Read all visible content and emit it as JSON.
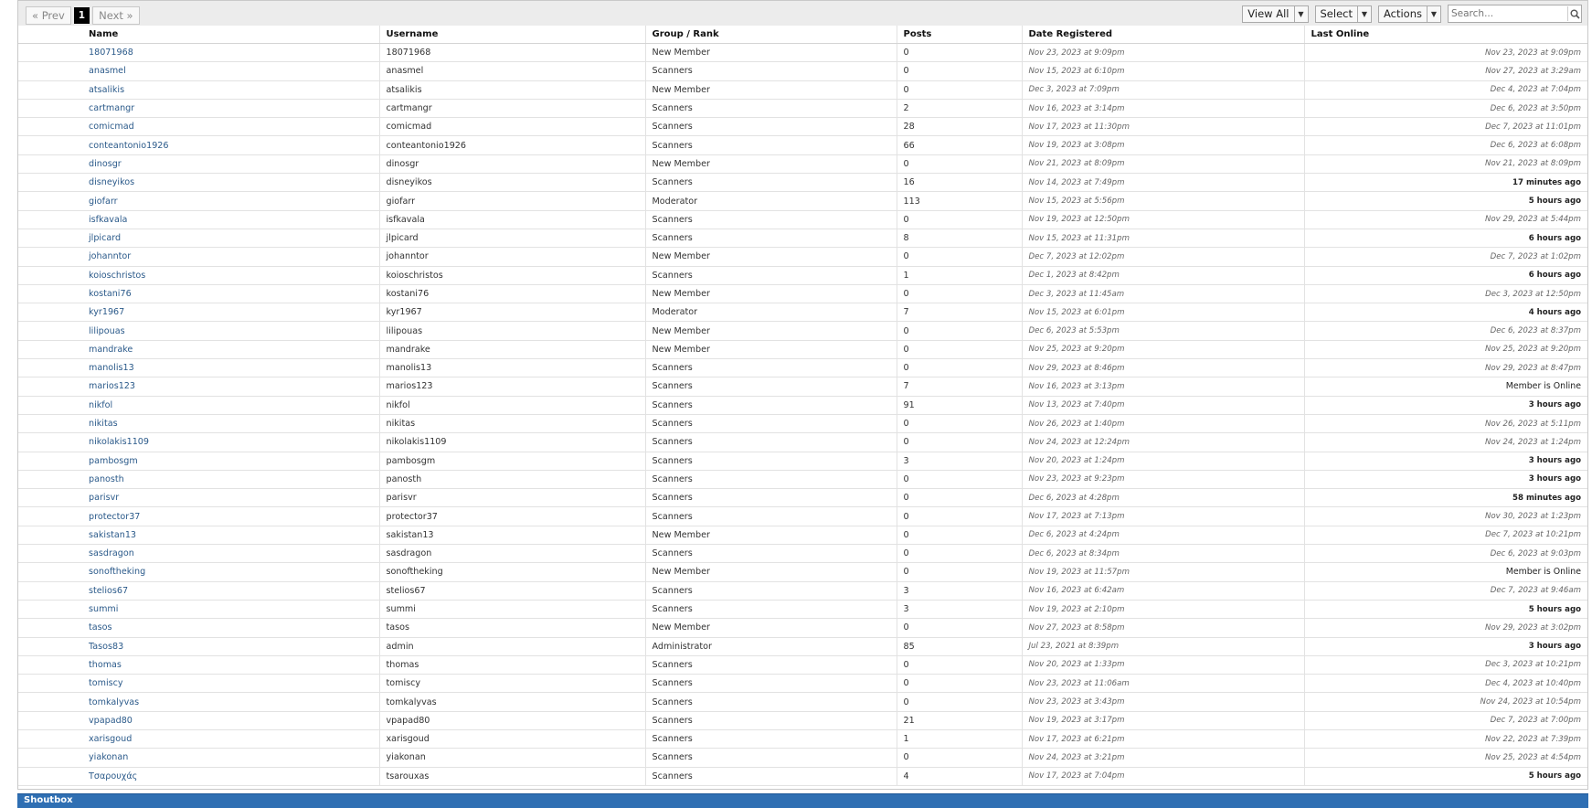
{
  "pagination": {
    "prev": "« Prev",
    "current": "1",
    "next": "Next »"
  },
  "tools": {
    "view_all": "View All",
    "select": "Select",
    "actions": "Actions",
    "search_placeholder": "Search..."
  },
  "columns": {
    "name": "Name",
    "username": "Username",
    "group": "Group / Rank",
    "posts": "Posts",
    "registered": "Date Registered",
    "last_online": "Last Online"
  },
  "members": [
    {
      "name": "18071968",
      "username": "18071968",
      "group": "New Member",
      "posts": "0",
      "registered": "Nov 23, 2023 at 9:09pm",
      "last": "Nov 23, 2023 at 9:09pm"
    },
    {
      "name": "anasmel",
      "username": "anasmel",
      "group": "Scanners",
      "posts": "0",
      "registered": "Nov 15, 2023 at 6:10pm",
      "last": "Nov 27, 2023 at 3:29am"
    },
    {
      "name": "atsalikis",
      "username": "atsalikis",
      "group": "New Member",
      "posts": "0",
      "registered": "Dec 3, 2023 at 7:09pm",
      "last": "Dec 4, 2023 at 7:04pm"
    },
    {
      "name": "cartmangr",
      "username": "cartmangr",
      "group": "Scanners",
      "posts": "2",
      "registered": "Nov 16, 2023 at 3:14pm",
      "last": "Dec 6, 2023 at 3:50pm"
    },
    {
      "name": "comicmad",
      "username": "comicmad",
      "group": "Scanners",
      "posts": "28",
      "registered": "Nov 17, 2023 at 11:30pm",
      "last": "Dec 7, 2023 at 11:01pm"
    },
    {
      "name": "conteantonio1926",
      "username": "conteantonio1926",
      "group": "Scanners",
      "posts": "66",
      "registered": "Nov 19, 2023 at 3:08pm",
      "last": "Dec 6, 2023 at 6:08pm"
    },
    {
      "name": "dinosgr",
      "username": "dinosgr",
      "group": "New Member",
      "posts": "0",
      "registered": "Nov 21, 2023 at 8:09pm",
      "last": "Nov 21, 2023 at 8:09pm"
    },
    {
      "name": "disneyikos",
      "username": "disneyikos",
      "group": "Scanners",
      "posts": "16",
      "registered": "Nov 14, 2023 at 7:49pm",
      "last": "17 minutes ago"
    },
    {
      "name": "giofarr",
      "username": "giofarr",
      "group": "Moderator",
      "posts": "113",
      "registered": "Nov 15, 2023 at 5:56pm",
      "last": "5 hours ago"
    },
    {
      "name": "isfkavala",
      "username": "isfkavala",
      "group": "Scanners",
      "posts": "0",
      "registered": "Nov 19, 2023 at 12:50pm",
      "last": "Nov 29, 2023 at 5:44pm"
    },
    {
      "name": "jlpicard",
      "username": "jlpicard",
      "group": "Scanners",
      "posts": "8",
      "registered": "Nov 15, 2023 at 11:31pm",
      "last": "6 hours ago"
    },
    {
      "name": "johanntor",
      "username": "johanntor",
      "group": "New Member",
      "posts": "0",
      "registered": "Dec 7, 2023 at 12:02pm",
      "last": "Dec 7, 2023 at 1:02pm"
    },
    {
      "name": "koioschristos",
      "username": "koioschristos",
      "group": "Scanners",
      "posts": "1",
      "registered": "Dec 1, 2023 at 8:42pm",
      "last": "6 hours ago"
    },
    {
      "name": "kostani76",
      "username": "kostani76",
      "group": "New Member",
      "posts": "0",
      "registered": "Dec 3, 2023 at 11:45am",
      "last": "Dec 3, 2023 at 12:50pm"
    },
    {
      "name": "kyr1967",
      "username": "kyr1967",
      "group": "Moderator",
      "posts": "7",
      "registered": "Nov 15, 2023 at 6:01pm",
      "last": "4 hours ago"
    },
    {
      "name": "lilipouas",
      "username": "lilipouas",
      "group": "New Member",
      "posts": "0",
      "registered": "Dec 6, 2023 at 5:53pm",
      "last": "Dec 6, 2023 at 8:37pm"
    },
    {
      "name": "mandrake",
      "username": "mandrake",
      "group": "New Member",
      "posts": "0",
      "registered": "Nov 25, 2023 at 9:20pm",
      "last": "Nov 25, 2023 at 9:20pm"
    },
    {
      "name": "manolis13",
      "username": "manolis13",
      "group": "Scanners",
      "posts": "0",
      "registered": "Nov 29, 2023 at 8:46pm",
      "last": "Nov 29, 2023 at 8:47pm"
    },
    {
      "name": "marios123",
      "username": "marios123",
      "group": "Scanners",
      "posts": "7",
      "registered": "Nov 16, 2023 at 3:13pm",
      "last": "Member is Online"
    },
    {
      "name": "nikfol",
      "username": "nikfol",
      "group": "Scanners",
      "posts": "91",
      "registered": "Nov 13, 2023 at 7:40pm",
      "last": "3 hours ago"
    },
    {
      "name": "nikitas",
      "username": "nikitas",
      "group": "Scanners",
      "posts": "0",
      "registered": "Nov 26, 2023 at 1:40pm",
      "last": "Nov 26, 2023 at 5:11pm"
    },
    {
      "name": "nikolakis1109",
      "username": "nikolakis1109",
      "group": "Scanners",
      "posts": "0",
      "registered": "Nov 24, 2023 at 12:24pm",
      "last": "Nov 24, 2023 at 1:24pm"
    },
    {
      "name": "pambosgm",
      "username": "pambosgm",
      "group": "Scanners",
      "posts": "3",
      "registered": "Nov 20, 2023 at 1:24pm",
      "last": "3 hours ago"
    },
    {
      "name": "panosth",
      "username": "panosth",
      "group": "Scanners",
      "posts": "0",
      "registered": "Nov 23, 2023 at 9:23pm",
      "last": "3 hours ago"
    },
    {
      "name": "parisvr",
      "username": "parisvr",
      "group": "Scanners",
      "posts": "0",
      "registered": "Dec 6, 2023 at 4:28pm",
      "last": "58 minutes ago"
    },
    {
      "name": "protector37",
      "username": "protector37",
      "group": "Scanners",
      "posts": "0",
      "registered": "Nov 17, 2023 at 7:13pm",
      "last": "Nov 30, 2023 at 1:23pm"
    },
    {
      "name": "sakistan13",
      "username": "sakistan13",
      "group": "New Member",
      "posts": "0",
      "registered": "Dec 6, 2023 at 4:24pm",
      "last": "Dec 7, 2023 at 10:21pm"
    },
    {
      "name": "sasdragon",
      "username": "sasdragon",
      "group": "Scanners",
      "posts": "0",
      "registered": "Dec 6, 2023 at 8:34pm",
      "last": "Dec 6, 2023 at 9:03pm"
    },
    {
      "name": "sonoftheking",
      "username": "sonoftheking",
      "group": "New Member",
      "posts": "0",
      "registered": "Nov 19, 2023 at 11:57pm",
      "last": "Member is Online"
    },
    {
      "name": "stelios67",
      "username": "stelios67",
      "group": "Scanners",
      "posts": "3",
      "registered": "Nov 16, 2023 at 6:42am",
      "last": "Dec 7, 2023 at 9:46am"
    },
    {
      "name": "summi",
      "username": "summi",
      "group": "Scanners",
      "posts": "3",
      "registered": "Nov 19, 2023 at 2:10pm",
      "last": "5 hours ago"
    },
    {
      "name": "tasos",
      "username": "tasos",
      "group": "New Member",
      "posts": "0",
      "registered": "Nov 27, 2023 at 8:58pm",
      "last": "Nov 29, 2023 at 3:02pm"
    },
    {
      "name": "Tasos83",
      "username": "admin",
      "group": "Administrator",
      "posts": "85",
      "registered": "Jul 23, 2021 at 8:39pm",
      "last": "3 hours ago"
    },
    {
      "name": "thomas",
      "username": "thomas",
      "group": "Scanners",
      "posts": "0",
      "registered": "Nov 20, 2023 at 1:33pm",
      "last": "Dec 3, 2023 at 10:21pm"
    },
    {
      "name": "tomiscy",
      "username": "tomiscy",
      "group": "Scanners",
      "posts": "0",
      "registered": "Nov 23, 2023 at 11:06am",
      "last": "Dec 4, 2023 at 10:40pm"
    },
    {
      "name": "tomkalyvas",
      "username": "tomkalyvas",
      "group": "Scanners",
      "posts": "0",
      "registered": "Nov 23, 2023 at 3:43pm",
      "last": "Nov 24, 2023 at 10:54pm"
    },
    {
      "name": "vpapad80",
      "username": "vpapad80",
      "group": "Scanners",
      "posts": "21",
      "registered": "Nov 19, 2023 at 3:17pm",
      "last": "Dec 7, 2023 at 7:00pm"
    },
    {
      "name": "xarisgoud",
      "username": "xarisgoud",
      "group": "Scanners",
      "posts": "1",
      "registered": "Nov 17, 2023 at 6:21pm",
      "last": "Nov 22, 2023 at 7:39pm"
    },
    {
      "name": "yiakonan",
      "username": "yiakonan",
      "group": "Scanners",
      "posts": "0",
      "registered": "Nov 24, 2023 at 3:21pm",
      "last": "Nov 25, 2023 at 4:54pm"
    },
    {
      "name": "Τσαρουχάς",
      "username": "tsarouxas",
      "group": "Scanners",
      "posts": "4",
      "registered": "Nov 17, 2023 at 7:04pm",
      "last": "5 hours ago"
    }
  ],
  "footer": {
    "shoutbox": "Shoutbox"
  },
  "colors": {
    "link": "#2b5a8a",
    "shoutbox_bar": "#2f6fb3",
    "toolbar_bg": "#ececec"
  },
  "icons": {
    "search": "magnifier-icon",
    "dropdown": "caret-down-icon"
  }
}
